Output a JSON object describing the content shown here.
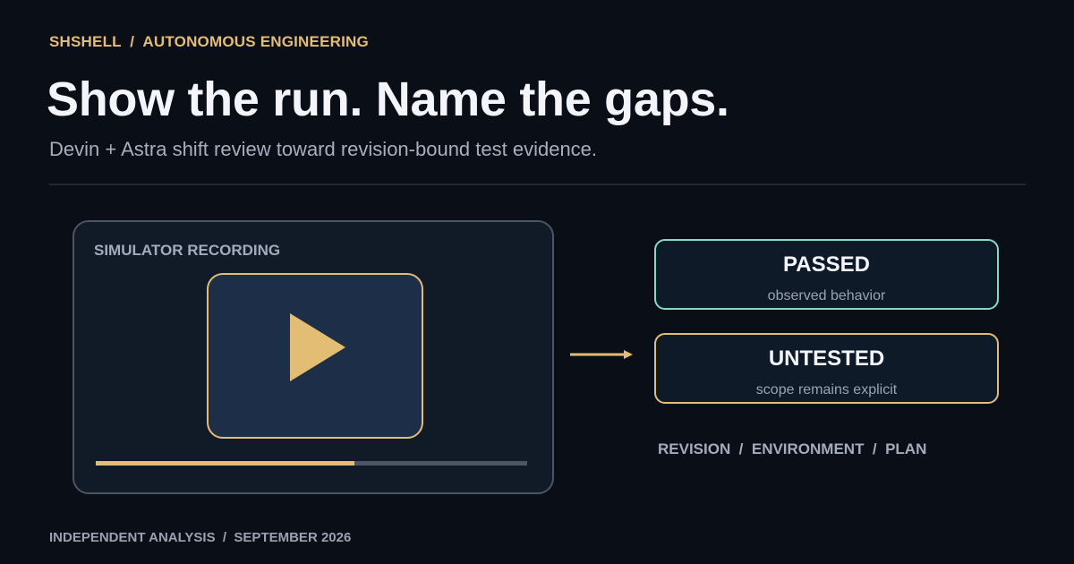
{
  "kicker": "SHSHELL  /  AUTONOMOUS ENGINEERING",
  "title": "Show the run. Name the gaps.",
  "subtitle": "Devin + Astra shift review toward revision-bound test evidence.",
  "player": {
    "label": "SIMULATOR RECORDING",
    "icon": "play-icon",
    "progress": 0.6
  },
  "statuses": [
    {
      "name": "PASSED",
      "description": "observed behavior",
      "color": "#86d9c4"
    },
    {
      "name": "UNTESTED",
      "description": "scope remains explicit",
      "color": "#e3bd74"
    }
  ],
  "tags": "REVISION  /  ENVIRONMENT  /  PLAN",
  "footer": "INDEPENDENT ANALYSIS  /  SEPTEMBER 2026",
  "colors": {
    "background": "#0a0e16",
    "accent": "#e3bd74",
    "passed": "#86d9c4",
    "title": "#f3f5fa"
  }
}
